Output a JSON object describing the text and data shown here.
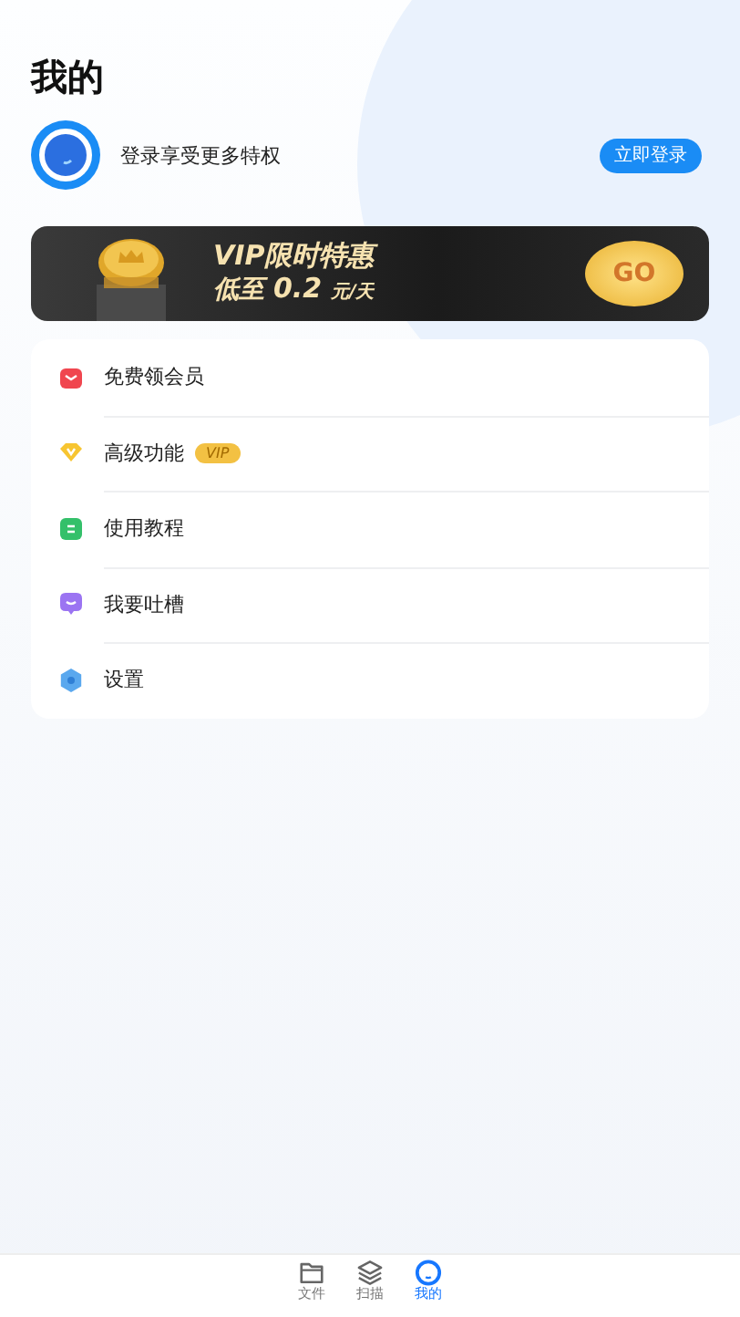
{
  "title": "我的",
  "login": {
    "prompt": "登录享受更多特权",
    "button": "立即登录"
  },
  "banner": {
    "headline": "VIP限时特惠",
    "price_prefix": "低至",
    "price": "0.2",
    "price_unit": "元/天",
    "button": "GO"
  },
  "menu": [
    {
      "kind": "gift",
      "label": "免费领会员"
    },
    {
      "kind": "diamond",
      "label": "高级功能",
      "badge": "VIP"
    },
    {
      "kind": "book",
      "label": "使用教程"
    },
    {
      "kind": "chat",
      "label": "我要吐槽"
    },
    {
      "kind": "gear",
      "label": "设置"
    }
  ],
  "nav": [
    {
      "kind": "folder",
      "label": "文件",
      "selected": false
    },
    {
      "kind": "layers",
      "label": "扫描",
      "selected": false
    },
    {
      "kind": "profile",
      "label": "我的",
      "selected": true
    }
  ]
}
